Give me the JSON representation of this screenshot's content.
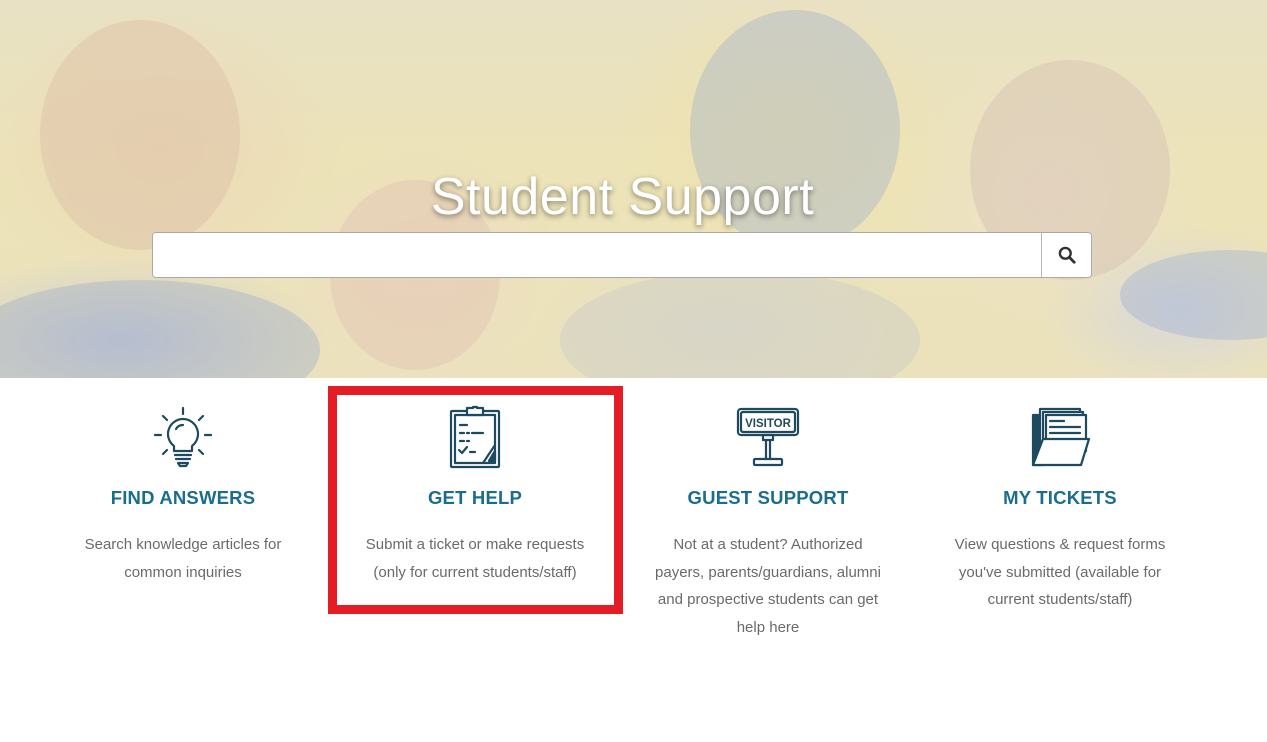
{
  "hero": {
    "title": "Student Support"
  },
  "search": {
    "value": "",
    "placeholder": "",
    "button_icon": "search-icon"
  },
  "cards": [
    {
      "icon": "lightbulb-icon",
      "title": "FIND ANSWERS",
      "description": "Search knowledge articles for common inquiries"
    },
    {
      "icon": "clipboard-checklist-icon",
      "title": "GET HELP",
      "description": "Submit a ticket or make requests (only for current students/staff)",
      "highlighted": true
    },
    {
      "icon": "visitor-sign-icon",
      "title": "GUEST SUPPORT",
      "icon_text": "VISITOR",
      "description": "Not at a student? Authorized payers, parents/guardians, alumni and prospective students can get help here"
    },
    {
      "icon": "folder-documents-icon",
      "title": "MY TICKETS",
      "description": "View questions & request forms you've submitted (available for current students/staff)"
    }
  ],
  "colors": {
    "accent": "#1a6d8f",
    "icon": "#1d4a5e",
    "highlight": "#e41d25",
    "body_text": "#6a6a6a"
  }
}
